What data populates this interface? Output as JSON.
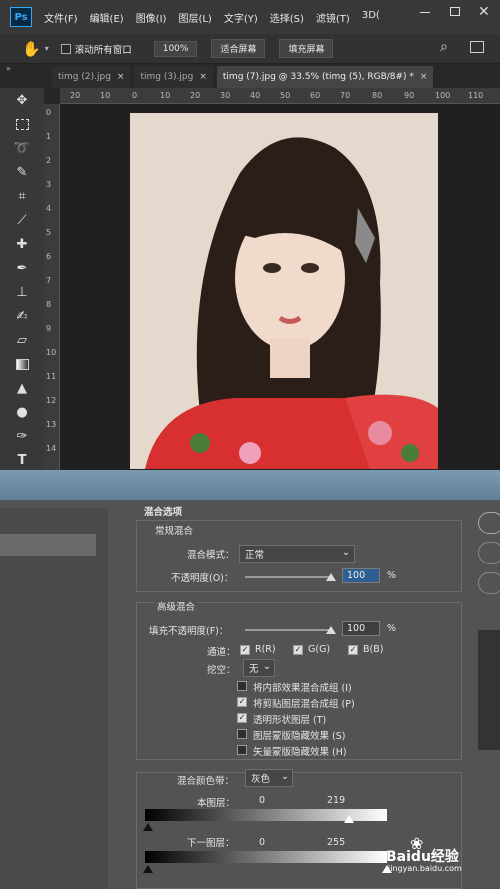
{
  "app": {
    "logo": "Ps",
    "menu": [
      "文件(F)",
      "编辑(E)",
      "图像(I)",
      "图层(L)",
      "文字(Y)",
      "选择(S)",
      "滤镜(T)",
      "3D("
    ]
  },
  "options_bar": {
    "hand_icon": "hand-icon",
    "scroll_all_label": "滚动所有窗口",
    "zoom": "100%",
    "fit_screen": "适合屏幕",
    "fill_screen": "填充屏幕"
  },
  "tabs": [
    {
      "label": "timg (2).jpg",
      "close": "×"
    },
    {
      "label": "timg (3).jpg",
      "close": "×"
    },
    {
      "label": "timg (7).jpg @ 33.5% (timg (5), RGB/8#) *",
      "close": "×"
    }
  ],
  "ruler": {
    "top": [
      "20",
      "10",
      "0",
      "10",
      "20",
      "30",
      "40",
      "50",
      "60",
      "70",
      "80",
      "90",
      "100",
      "110"
    ],
    "left": [
      "0",
      "1",
      "2",
      "3",
      "4",
      "5",
      "6",
      "7",
      "8",
      "9",
      "10",
      "11",
      "12",
      "13",
      "14"
    ]
  },
  "dialog": {
    "blending_options": "混合选项",
    "general_blending": "常规混合",
    "blend_mode_label": "混合模式：",
    "blend_mode_value": "正常",
    "opacity_label": "不透明度(O)：",
    "opacity_value": "100",
    "percent": "%",
    "advanced_blending": "高级混合",
    "fill_opacity_label": "填充不透明度(F)：",
    "fill_opacity_value": "100",
    "channels_label": "通道：",
    "channel_r": "R(R)",
    "channel_g": "G(G)",
    "channel_b": "B(B)",
    "knockout_label": "挖空：",
    "knockout_value": "无",
    "opt1": "将内部效果混合成组 (I)",
    "opt2": "将剪贴图层混合成组 (P)",
    "opt3": "透明形状图层 (T)",
    "opt4": "图层蒙版隐藏效果 (S)",
    "opt5": "矢量蒙版隐藏效果 (H)",
    "blend_if_label": "混合颜色带：",
    "blend_if_value": "灰色",
    "this_layer": "本图层：",
    "this_layer_min": "0",
    "this_layer_max": "219",
    "underlying_layer": "下一图层：",
    "underlying_min": "0",
    "underlying_max": "255"
  },
  "watermark": {
    "brand": "Baidu经验",
    "url": "jingyan.baidu.com"
  },
  "colors": {
    "accent": "#31a8ff",
    "dialog_bg": "#535353",
    "titlebar": "#383838"
  }
}
